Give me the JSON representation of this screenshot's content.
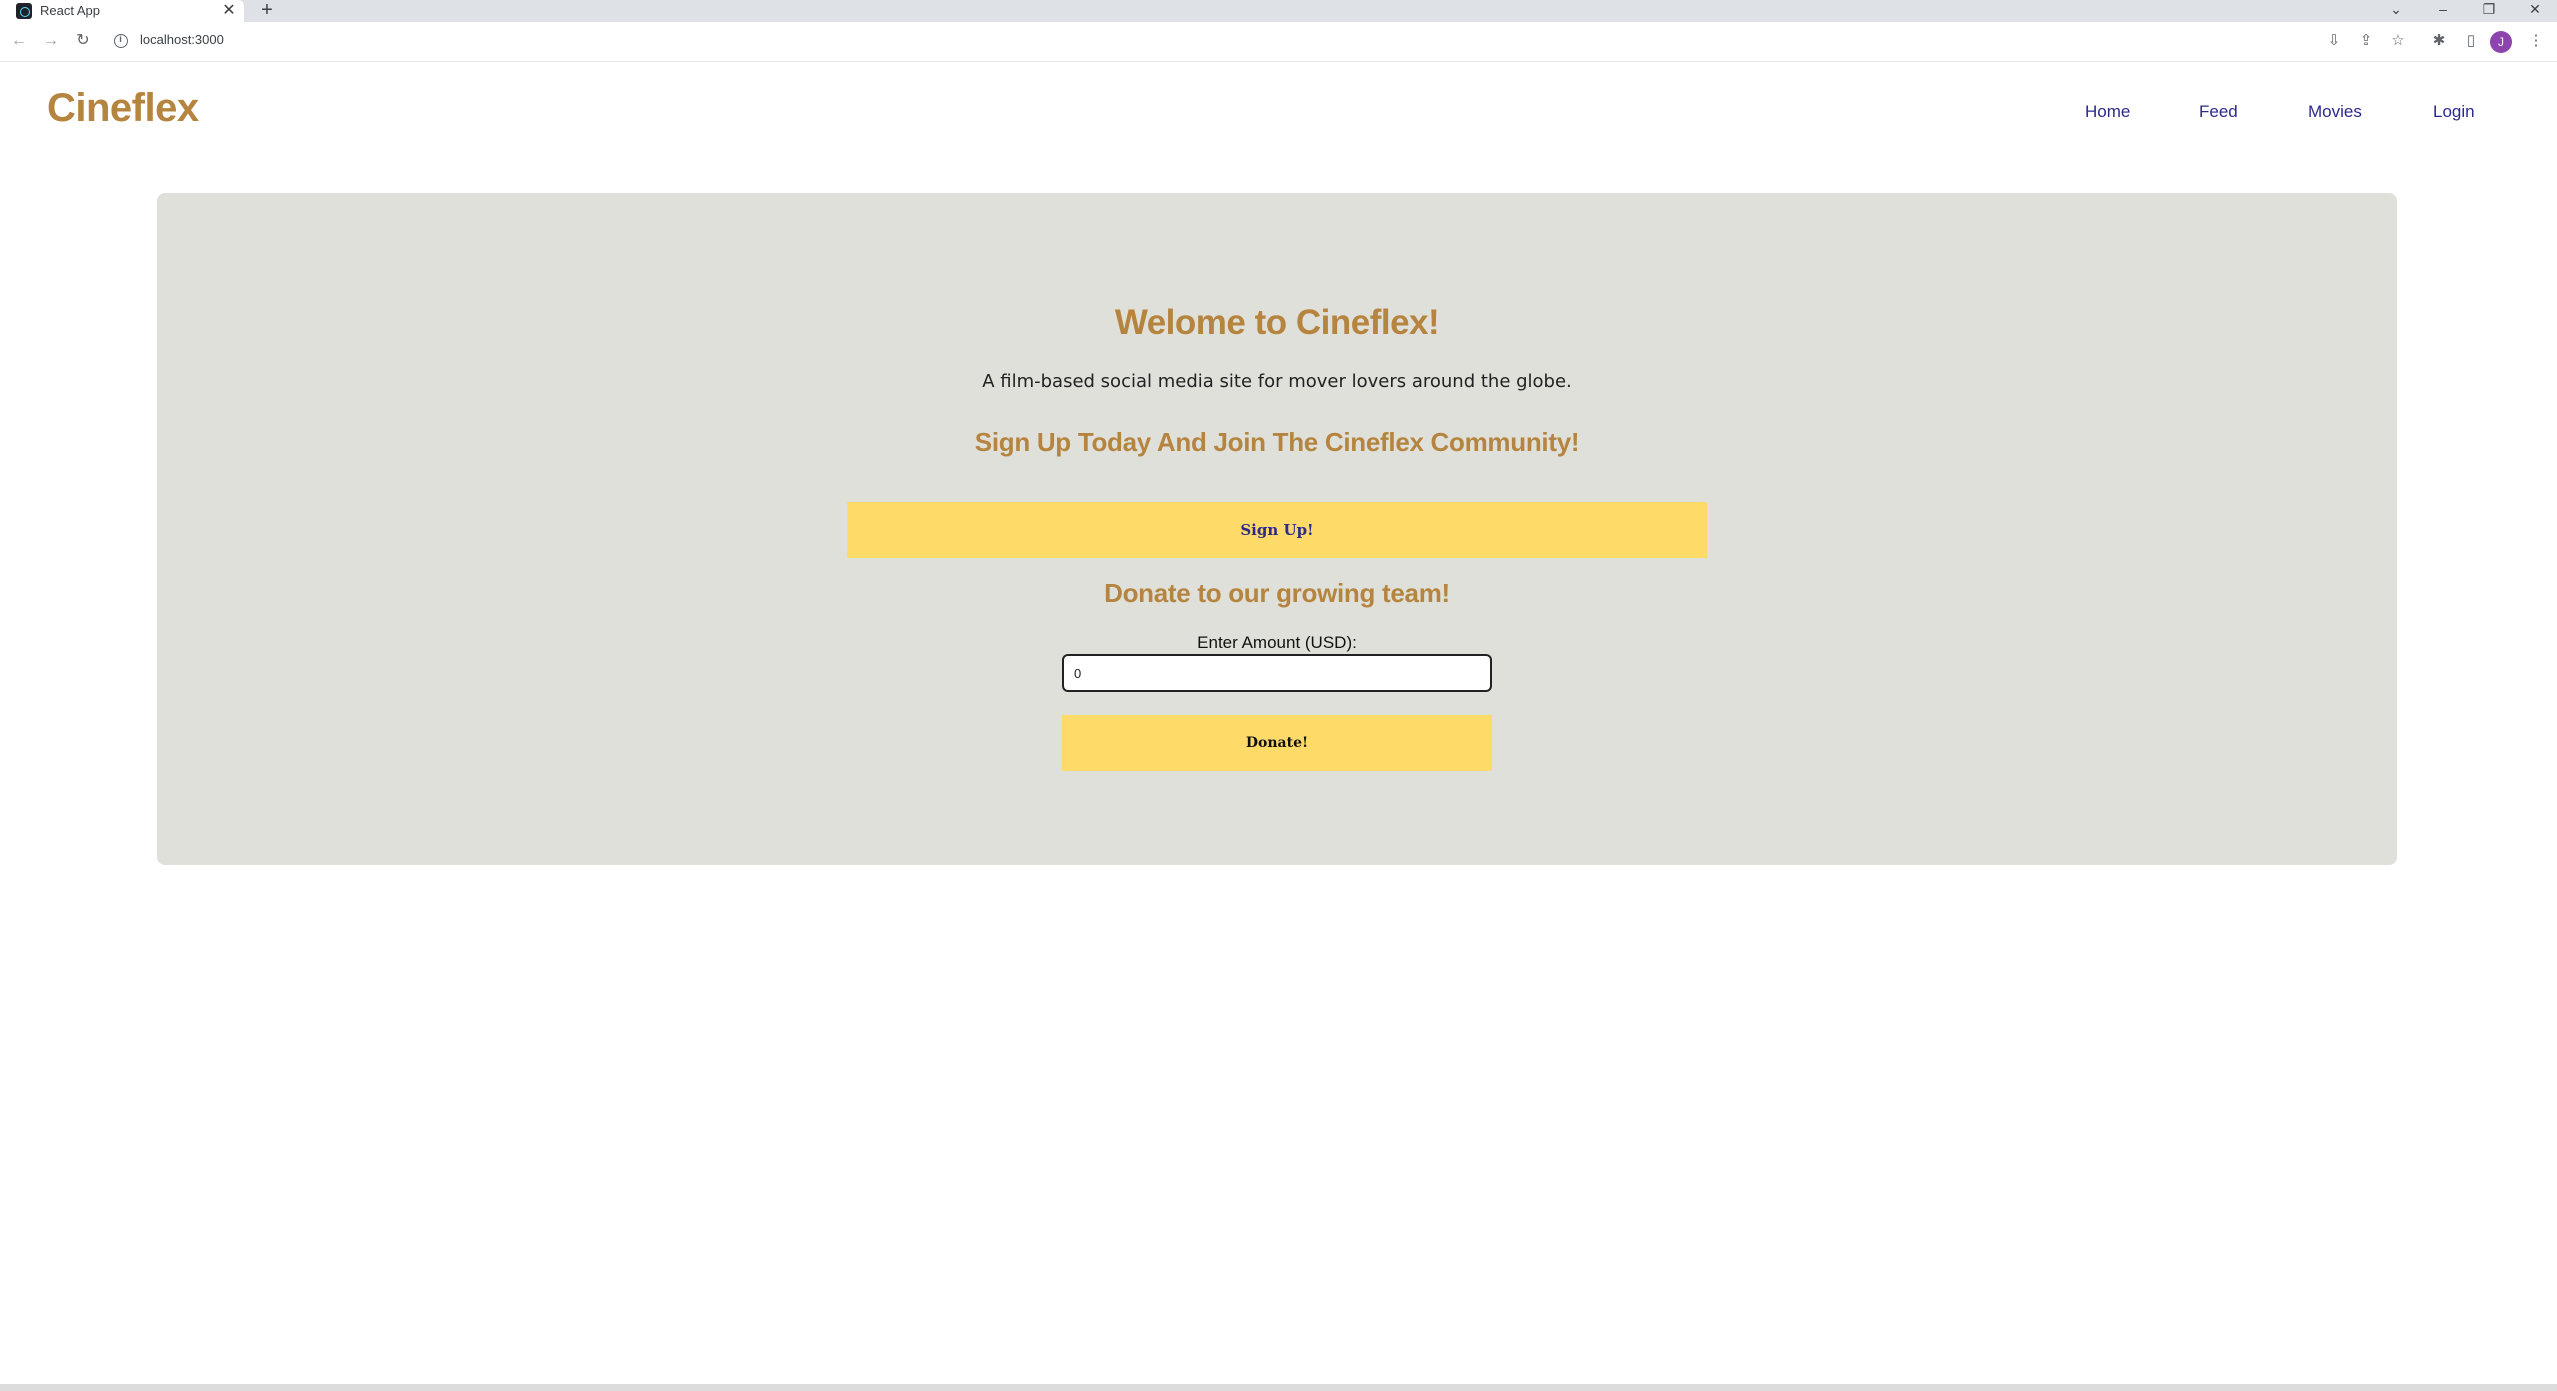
{
  "browser": {
    "tab_title": "React App",
    "tab_close": "✕",
    "new_tab": "+",
    "url": "localhost:3000",
    "back": "←",
    "forward": "→",
    "reload": "↻",
    "window_controls": {
      "dropdown": "⌄",
      "minimize": "–",
      "restore": "❐",
      "close": "✕"
    },
    "profile_initial": "J",
    "toolbar_icons": {
      "install": "⇩",
      "share": "⇪",
      "bookmark": "☆",
      "extensions": "✱",
      "sidepanel": "▯",
      "menu": "⋮"
    }
  },
  "header": {
    "brand": "Cineflex",
    "nav": [
      "Home",
      "Feed",
      "Movies",
      "Login"
    ]
  },
  "hero": {
    "title": "Welome to Cineflex!",
    "subtitle": "A film-based social media site for mover lovers around the globe.",
    "signup_heading": "Sign Up Today And Join The Cineflex Community!",
    "signup_button": "Sign Up!",
    "donate_heading": "Donate to our growing team!",
    "amount_label": "Enter Amount (USD):",
    "amount_value": "0",
    "donate_button": "Donate!"
  },
  "colors": {
    "brand": "#b5843f",
    "nav_link": "#2d2a8c",
    "hero_bg": "#e0e0da",
    "button_bg": "#fedb68"
  }
}
